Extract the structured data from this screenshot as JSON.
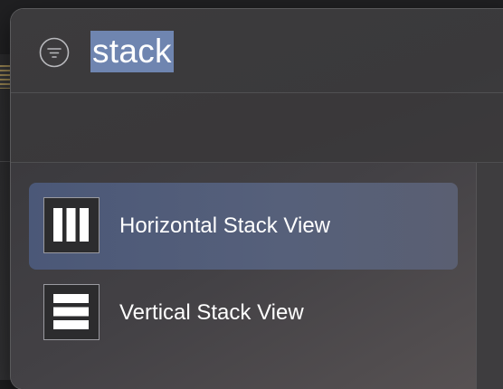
{
  "search": {
    "query": "stack",
    "filter_icon": "filter-icon"
  },
  "results": [
    {
      "label": "Horizontal Stack View",
      "icon": "horizontal-stack-icon",
      "selected": true
    },
    {
      "label": "Vertical Stack View",
      "icon": "vertical-stack-icon",
      "selected": false
    }
  ],
  "colors": {
    "selection": "#4b5878",
    "search_highlight": "#6f85b0",
    "panel_bg": "#3c3b3d"
  }
}
